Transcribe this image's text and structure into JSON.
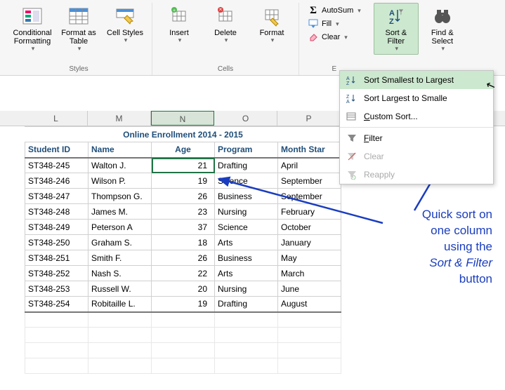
{
  "ribbon": {
    "styles_group": "Styles",
    "cells_group": "Cells",
    "editing_group": "E",
    "conditional_formatting": "Conditional Formatting",
    "format_as_table": "Format as Table",
    "cell_styles": "Cell Styles",
    "insert": "Insert",
    "delete": "Delete",
    "format": "Format",
    "autosum": "AutoSum",
    "fill": "Fill",
    "clear": "Clear",
    "sort_filter": "Sort & Filter",
    "find_select": "Find & Select"
  },
  "columns": [
    "L",
    "M",
    "N",
    "O",
    "P"
  ],
  "selected_column_index": 2,
  "title": "Online Enrollment 2014 - 2015",
  "headers": [
    "Student ID",
    "Name",
    "Age",
    "Program",
    "Month Star"
  ],
  "rows": [
    {
      "id": "ST348-245",
      "name": "Walton J.",
      "age": 21,
      "program": "Drafting",
      "month": "April"
    },
    {
      "id": "ST348-246",
      "name": "Wilson P.",
      "age": 19,
      "program": "Science",
      "month": "September"
    },
    {
      "id": "ST348-247",
      "name": "Thompson G.",
      "age": 26,
      "program": "Business",
      "month": "September"
    },
    {
      "id": "ST348-248",
      "name": "James M.",
      "age": 23,
      "program": "Nursing",
      "month": "February"
    },
    {
      "id": "ST348-249",
      "name": "Peterson A",
      "age": 37,
      "program": "Science",
      "month": "October"
    },
    {
      "id": "ST348-250",
      "name": "Graham S.",
      "age": 18,
      "program": "Arts",
      "month": "January"
    },
    {
      "id": "ST348-251",
      "name": "Smith F.",
      "age": 26,
      "program": "Business",
      "month": "May"
    },
    {
      "id": "ST348-252",
      "name": "Nash S.",
      "age": 22,
      "program": "Arts",
      "month": "March"
    },
    {
      "id": "ST348-253",
      "name": "Russell W.",
      "age": 20,
      "program": "Nursing",
      "month": "June"
    },
    {
      "id": "ST348-254",
      "name": "Robitaille L.",
      "age": 19,
      "program": "Drafting",
      "month": "August"
    }
  ],
  "selected_cell": {
    "row": 0,
    "col": 2
  },
  "menu": {
    "sort_asc": "Sort Smallest to Largest",
    "sort_desc": "Sort Largest to Smalle",
    "custom": "Custom Sort...",
    "filter": "Filter",
    "clear": "Clear",
    "reapply": "Reapply"
  },
  "annotation": {
    "l1": "Quick sort on",
    "l2": "one column",
    "l3": "using the",
    "l4": "Sort & Filter",
    "l5": "button"
  },
  "chart_data": {
    "type": "table",
    "title": "Online Enrollment 2014 - 2015",
    "columns": [
      "Student ID",
      "Name",
      "Age",
      "Program",
      "Month Started"
    ],
    "rows": [
      [
        "ST348-245",
        "Walton J.",
        21,
        "Drafting",
        "April"
      ],
      [
        "ST348-246",
        "Wilson P.",
        19,
        "Science",
        "September"
      ],
      [
        "ST348-247",
        "Thompson G.",
        26,
        "Business",
        "September"
      ],
      [
        "ST348-248",
        "James M.",
        23,
        "Nursing",
        "February"
      ],
      [
        "ST348-249",
        "Peterson A",
        37,
        "Science",
        "October"
      ],
      [
        "ST348-250",
        "Graham S.",
        18,
        "Arts",
        "January"
      ],
      [
        "ST348-251",
        "Smith F.",
        26,
        "Business",
        "May"
      ],
      [
        "ST348-252",
        "Nash S.",
        22,
        "Arts",
        "March"
      ],
      [
        "ST348-253",
        "Russell W.",
        20,
        "Nursing",
        "June"
      ],
      [
        "ST348-254",
        "Robitaille L.",
        19,
        "Drafting",
        "August"
      ]
    ]
  }
}
